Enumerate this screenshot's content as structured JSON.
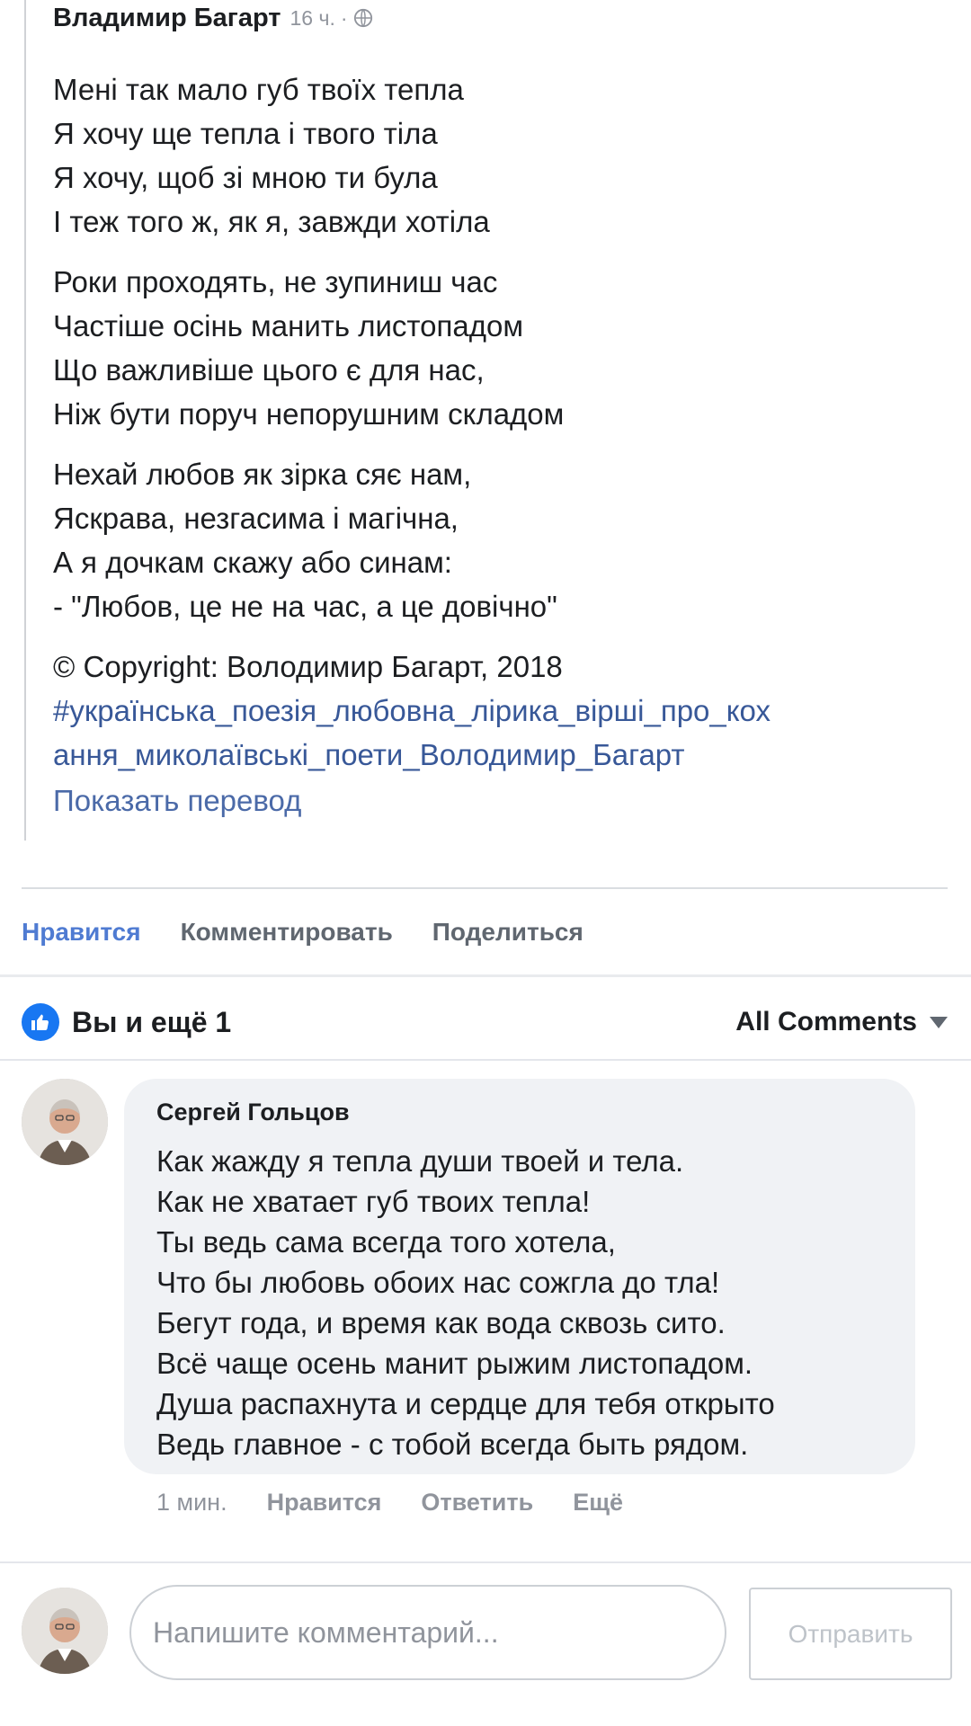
{
  "post": {
    "author": "Владимир Багарт",
    "time": "16 ч.",
    "separator": "·",
    "privacy_icon": "globe-icon",
    "stanzas": [
      [
        "Мені так мало губ твоїх тепла",
        "Я хочу ще тепла і твого тіла",
        "Я хочу, щоб зі мною ти була",
        "І теж того ж, як я, завжди хотіла"
      ],
      [
        "Роки проходять, не зупиниш час",
        "Частіше осінь манить листопадом",
        "Що важливіше цього є для нас,",
        "Ніж бути поруч непорушним складом"
      ],
      [
        "Нехай любов як зірка сяє нам,",
        "Яскрава, незгасима і магічна,",
        "А я дочкам скажу або синам:",
        "- \"Любов, це не на час, а це довічно\""
      ]
    ],
    "copyright": "© Copyright: Володимир Багарт, 2018",
    "hashtags": [
      "#українська_поезія_любовна_лірика_вірші_про_кох",
      "ання_миколаївські_поети_Володимир_Багарт"
    ],
    "translate": "Показать перевод"
  },
  "actions": {
    "like": "Нравится",
    "comment": "Комментировать",
    "share": "Поделиться"
  },
  "reactions": {
    "icon": "like-icon",
    "text": "Вы и ещё 1"
  },
  "sort": {
    "label": "All Comments"
  },
  "comment": {
    "author": "Сергей Гольцов",
    "lines": [
      "Как жажду я тепла души твоей и тела.",
      "Как не хватает губ твоих тепла!",
      "Ты ведь сама всегда того хотела,",
      "Что бы любовь обоих нас сожгла до тла!",
      "Бегут года, и время как вода сквозь сито.",
      "Всё чаще осень манит рыжим листопадом.",
      "Душа распахнута и сердце для тебя открыто",
      "Ведь главное - с тобой всегда быть рядом."
    ],
    "time": "1 мин.",
    "like": "Нравится",
    "reply": "Ответить",
    "more": "Ещё"
  },
  "composer": {
    "placeholder": "Напишите комментарий...",
    "value": "",
    "send": "Отправить"
  },
  "colors": {
    "accent_like": "#4f7bd2",
    "hashtag": "#385898",
    "bubble": "#f0f2f5",
    "like_badge": "#1877f2"
  }
}
